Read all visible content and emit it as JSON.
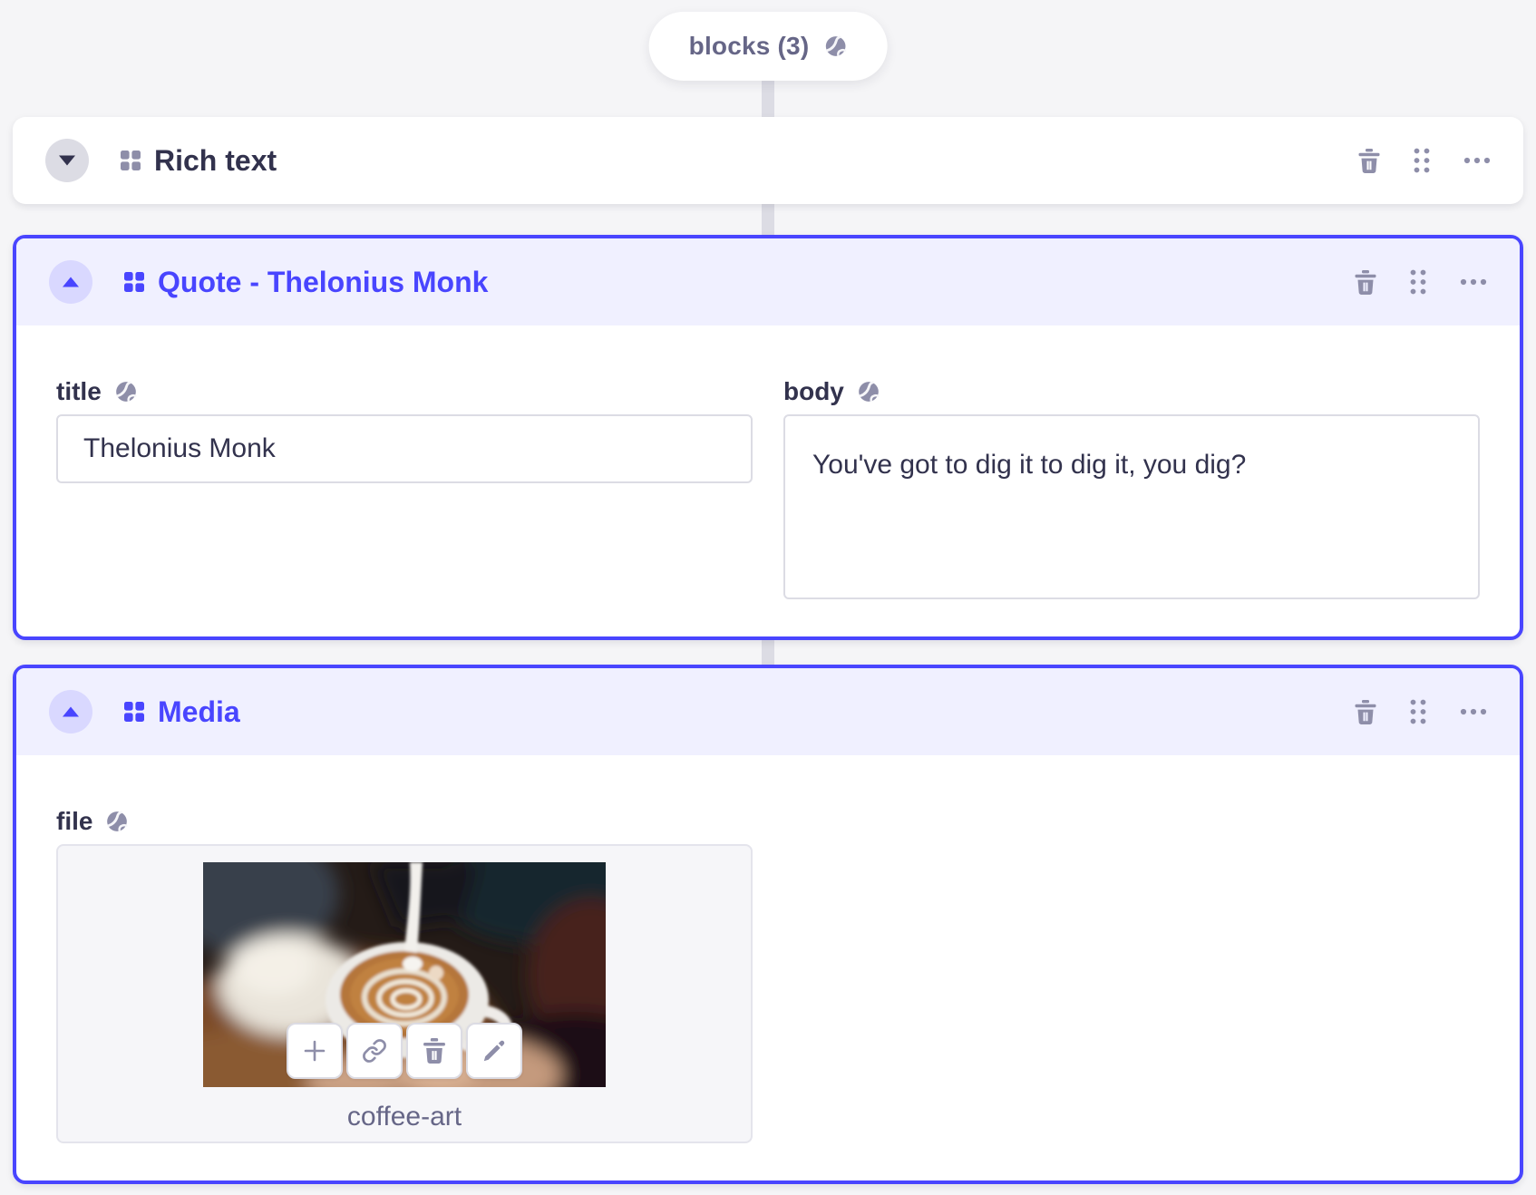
{
  "colors": {
    "primary": "#4945ff",
    "primary_header_bg": "#f0f0ff",
    "primary_circle_bg": "#d9d8ff",
    "neutral_icon": "#8e8ea9",
    "text_dark": "#32324d",
    "text_muted": "#666687",
    "field_border": "#dcdce4",
    "connector": "#dcdce4",
    "page_bg": "#f5f5f7",
    "media_card_bg": "#f6f6f9"
  },
  "pill": {
    "label": "blocks (3)",
    "icon": "globe-icon"
  },
  "blocks": [
    {
      "label": "Rich text",
      "state": "collapsed"
    },
    {
      "label": "Quote - Thelonius Monk",
      "state": "expanded",
      "fields": {
        "title": {
          "label": "title",
          "value": "Thelonius Monk"
        },
        "body": {
          "label": "body",
          "value": "You've got to dig it to dig it, you dig?"
        }
      }
    },
    {
      "label": "Media",
      "state": "expanded",
      "fields": {
        "file": {
          "label": "file",
          "filename": "coffee-art"
        }
      }
    }
  ]
}
